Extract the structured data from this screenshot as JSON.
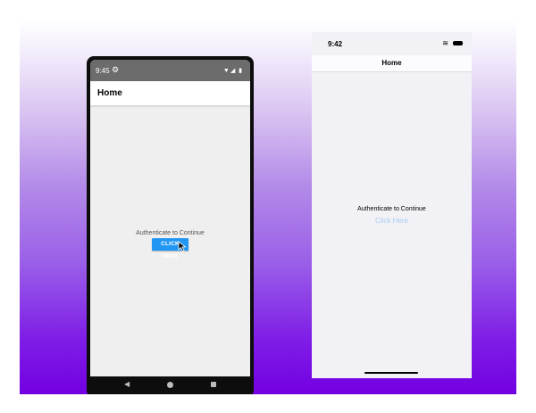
{
  "android": {
    "status_time": "9:45",
    "status_icons": "▼◢ ▮",
    "appbar_title": "Home",
    "prompt_text": "Authenticate to Continue",
    "button_label": "CLICK HERE",
    "accent_color": "#2196f3",
    "nav": {
      "back_icon": "◀"
    }
  },
  "ios": {
    "status_time": "9:42",
    "wifi_icon": "≋",
    "nav_title": "Home",
    "prompt_text": "Authenticate to Continue",
    "link_label": "Click Here",
    "link_color": "#a7cdf2"
  }
}
